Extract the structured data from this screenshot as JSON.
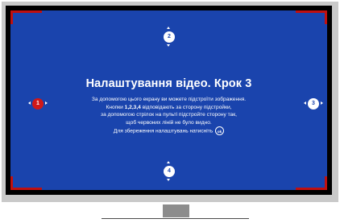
{
  "screen": {
    "title": "Налаштування відео. Крок 3",
    "lines": [
      "За допомогою цього екрану ви можете підстроїти зображення.",
      "відповідають за сторону підстройки,",
      "за допомогою стрілок на пульті підстройте сторону так,",
      "щоб червоних ліній не було видно.",
      "Для збереження налаштувань натисніть"
    ],
    "line2_prefix": "Кнопки",
    "line2_keys": "1,2,3,4",
    "ok_label": "ok"
  },
  "controls": {
    "top": "2",
    "left": "1",
    "right": "3",
    "bottom": "4"
  },
  "colors": {
    "screen_bg": "#1a44ad",
    "border_lines": "#c01010",
    "active_control": "#d01818"
  }
}
